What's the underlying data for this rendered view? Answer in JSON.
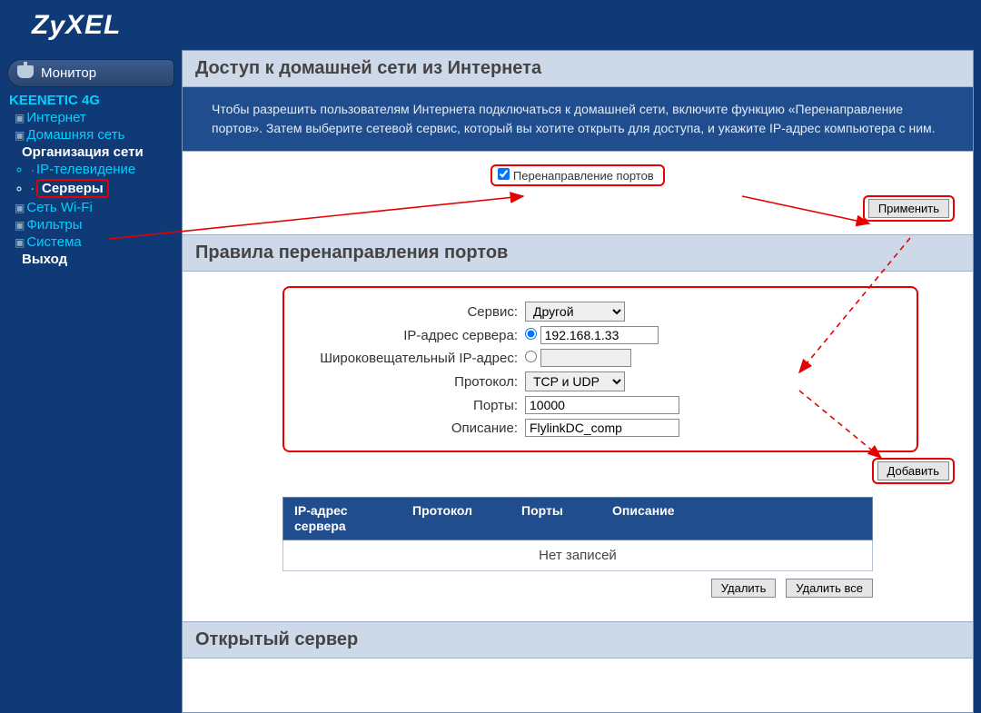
{
  "brand": "ZyXEL",
  "sidebar": {
    "monitor": "Монитор",
    "device": "KEENETIC 4G",
    "items": [
      "Интернет",
      "Домашняя сеть"
    ],
    "section": "Организация сети",
    "subitems": [
      "IP-телевидение",
      "Серверы"
    ],
    "items2": [
      "Сеть Wi-Fi",
      "Фильтры",
      "Система"
    ],
    "exit": "Выход"
  },
  "section1": {
    "title": "Доступ к домашней сети из Интернета",
    "desc": "Чтобы разрешить пользователям Интернета подключаться к домашней сети, включите функцию «Перенаправление портов». Затем выберите сетевой сервис, который вы хотите открыть для доступа, и укажите IP-адрес компьютера с ним.",
    "checkbox_label": "Перенаправление портов",
    "apply": "Применить"
  },
  "section2": {
    "title": "Правила перенаправления портов",
    "labels": {
      "service": "Сервис:",
      "server_ip": "IP-адрес сервера:",
      "broadcast_ip": "Широковещательный IP-адрес:",
      "protocol": "Протокол:",
      "ports": "Порты:",
      "description": "Описание:"
    },
    "values": {
      "service": "Другой",
      "server_ip": "192.168.1.33",
      "broadcast_ip": "",
      "protocol": "TCP и UDP",
      "ports": "10000",
      "description": "FlylinkDC_comp"
    },
    "add": "Добавить",
    "table": {
      "headers": {
        "ip": "IP-адрес сервера",
        "proto": "Протокол",
        "ports": "Порты",
        "desc": "Описание"
      },
      "empty": "Нет записей"
    },
    "delete": "Удалить",
    "delete_all": "Удалить все"
  },
  "section3": {
    "title": "Открытый сервер"
  }
}
